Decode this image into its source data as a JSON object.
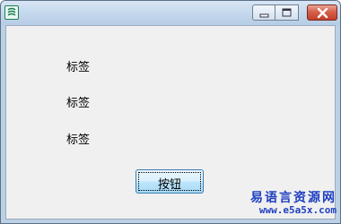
{
  "window": {
    "title": "",
    "controls": {
      "minimize": "minimize-icon",
      "maximize": "maximize-icon",
      "close": "close-icon"
    }
  },
  "labels": [
    "标签",
    "标签",
    "标签"
  ],
  "button": {
    "label": "按钮"
  },
  "watermark": {
    "title": "易语言资源网",
    "url": "www.e5a5x.com"
  },
  "colors": {
    "client_bg": "#f0f0f0",
    "close_button": "#c9462f",
    "watermark": "#1f3fc0",
    "title_bar": "#c3d7ec"
  }
}
